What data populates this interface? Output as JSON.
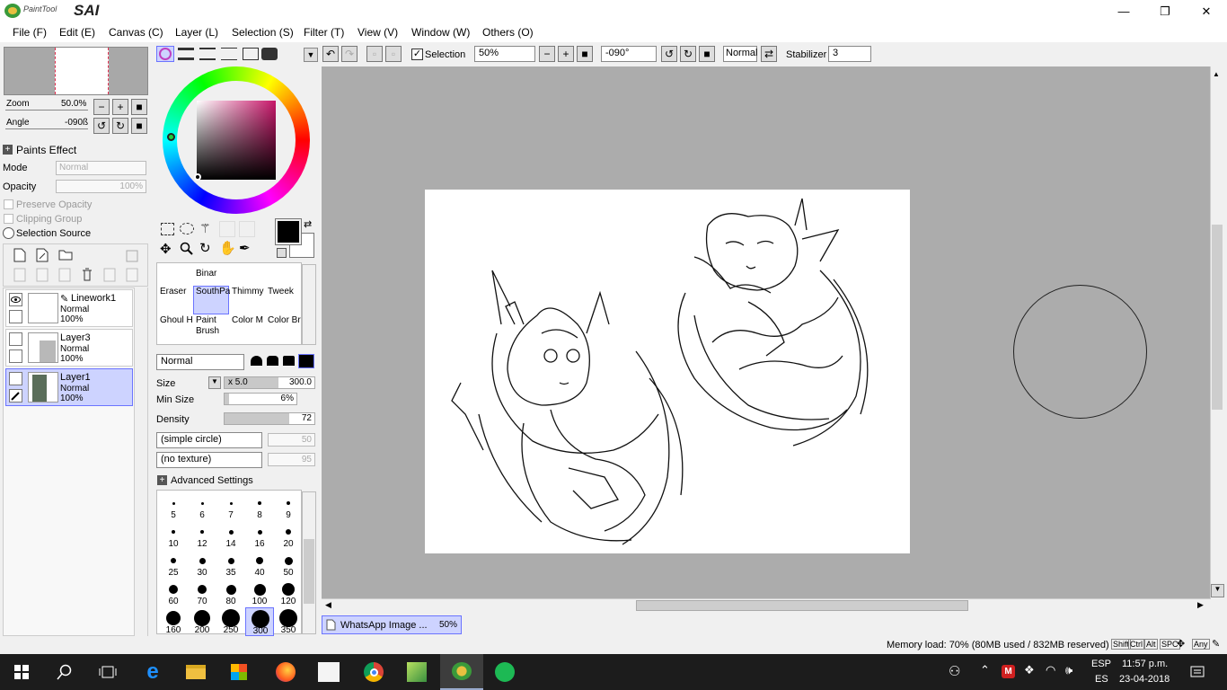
{
  "app": {
    "title": "PaintTool SAI",
    "logo_small": "PaintTool",
    "logo_big": "SAI"
  },
  "window_controls": {
    "minimize": "—",
    "maximize": "❐",
    "close": "✕"
  },
  "menu": [
    "File (F)",
    "Edit (E)",
    "Canvas (C)",
    "Layer (L)",
    "Selection (S)",
    "Filter (T)",
    "View (V)",
    "Window (W)",
    "Others (O)"
  ],
  "navigator": {
    "zoom_label": "Zoom",
    "zoom_value": "50.0%",
    "angle_label": "Angle",
    "angle_value": "-090ß"
  },
  "paints_effect": {
    "title": "Paints Effect",
    "mode_label": "Mode",
    "mode_value": "Normal",
    "opacity_label": "Opacity",
    "opacity_value": "100%",
    "preserve_opacity": "Preserve Opacity",
    "clipping_group": "Clipping Group",
    "selection_source": "Selection Source"
  },
  "layers": [
    {
      "name": "Linework1",
      "mode": "Normal",
      "opacity": "100%",
      "visible": true,
      "selected": false
    },
    {
      "name": "Layer3",
      "mode": "Normal",
      "opacity": "100%",
      "visible": false,
      "selected": false
    },
    {
      "name": "Layer1",
      "mode": "Normal",
      "opacity": "100%",
      "visible": false,
      "selected": true
    }
  ],
  "tools": [
    {
      "name": "Binar"
    },
    {
      "name": "Eraser"
    },
    {
      "name": "SouthPa"
    },
    {
      "name": "Thimmy"
    },
    {
      "name": "Tweek"
    },
    {
      "name": "Ghoul H"
    },
    {
      "name": "Paint Brush"
    },
    {
      "name": "Color M"
    },
    {
      "name": "Color Br"
    }
  ],
  "brush": {
    "blend_mode": "Normal",
    "size_label": "Size",
    "size_mult": "x 5.0",
    "size_value": "300.0",
    "min_size_label": "Min Size",
    "min_size_value": "6%",
    "min_size_fraction": 0.06,
    "density_label": "Density",
    "density_value": "72",
    "density_fraction": 0.72,
    "shape": "(simple circle)",
    "shape_value": "50",
    "texture": "(no texture)",
    "texture_value": "95",
    "advanced": "Advanced Settings"
  },
  "brush_sizes": [
    "5",
    "6",
    "7",
    "8",
    "9",
    "10",
    "12",
    "14",
    "16",
    "20",
    "25",
    "30",
    "35",
    "40",
    "50",
    "60",
    "70",
    "80",
    "100",
    "120",
    "160",
    "200",
    "250",
    "300",
    "350"
  ],
  "selected_brush_size": "300",
  "toolbar": {
    "selection_label": "Selection",
    "selection_checked": true,
    "zoom": "50%",
    "angle": "-090°",
    "blend": "Normal",
    "stabilizer_label": "Stabilizer",
    "stabilizer_value": "3"
  },
  "document_tab": {
    "name": "WhatsApp Image ...",
    "zoom": "50%"
  },
  "status": {
    "memory": "Memory load: 70% (80MB used / 832MB reserved)",
    "keys": [
      "Shift",
      "Ctrl",
      "Alt",
      "SPC",
      "Any"
    ]
  },
  "taskbar": {
    "lang1": "ESP",
    "lang2": "ES",
    "time": "11:57 p.m.",
    "date": "23-04-2018",
    "apps": [
      "edge-icon",
      "file-explorer-icon",
      "store-icon",
      "firefox-icon",
      "sketch-icon",
      "chrome-icon",
      "drawing-app-icon",
      "sai-icon",
      "spotify-icon"
    ]
  },
  "colors": {
    "accent": "#6b74ff",
    "selected_bg": "#cdd3ff",
    "foreground": "#000000",
    "background": "#ffffff"
  }
}
